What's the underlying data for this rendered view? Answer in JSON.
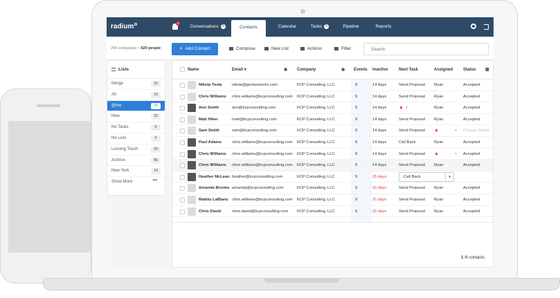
{
  "app": {
    "logo": "radium",
    "bell_count": "3"
  },
  "nav": {
    "tabs": [
      {
        "label": "Conversations",
        "count": "5"
      },
      {
        "label": "Contacts",
        "active": true
      },
      {
        "label": "Calendar"
      },
      {
        "label": "Tasks",
        "count": "5"
      },
      {
        "label": "Pipeline"
      },
      {
        "label": "Reports"
      }
    ]
  },
  "toolbar": {
    "companies": "265 companies",
    "sep": ">",
    "people": "620 people",
    "add_contact": "Add Contact",
    "plus": "+",
    "compose": "Compose",
    "new_list": "New List",
    "actions": "Actions",
    "filter": "Filter",
    "search_placeholder": "Search"
  },
  "sidebar": {
    "title": "Lists",
    "items": [
      {
        "label": "Merge",
        "count": "20"
      },
      {
        "label": "All",
        "count": "19"
      },
      {
        "label": "@me",
        "count": "20",
        "active": true
      },
      {
        "label": "New",
        "count": "20"
      },
      {
        "label": "No Tasks",
        "count": "6"
      },
      {
        "label": "No Lists",
        "count": "5"
      },
      {
        "label": "Loosing Touch",
        "count": "20"
      },
      {
        "label": "Archive",
        "count": "86"
      },
      {
        "label": "New York",
        "count": "14"
      }
    ],
    "more": "Show More",
    "more_dots": "•••"
  },
  "table": {
    "headers": {
      "name": "Name",
      "email": "Email",
      "email_sort": "▾",
      "company": "Company",
      "events": "Events",
      "inactive": "Inactive",
      "next_task": "Next Task",
      "assigned": "Assigned",
      "status": "Status"
    },
    "rows": [
      {
        "name": "Nikola Tesla",
        "email": "nikola@geniusworks.com",
        "company": "KCP Consulting, LLC",
        "events": "9",
        "inactive": "14 days",
        "next_task": "Send Proposal",
        "assigned": "Ryan",
        "status": "Accepted"
      },
      {
        "name": "Chris Williams",
        "email": "chris.williams@kcpconsulting.com",
        "company": "KCP Consulting, LLC",
        "events": "9",
        "inactive": "14 days",
        "next_task": "Send Proposal",
        "assigned": "Ryan",
        "status": "Accepted"
      },
      {
        "name": "Ann Smith",
        "email": "ann@kcpconsulting.com",
        "company": "KCP Consulting, LLC",
        "events": "9",
        "inactive": "14 days",
        "next_task": "",
        "assigned": "Ryan",
        "status": "Accepted"
      },
      {
        "name": "Matt Hiker",
        "email": "matt@kcpconsulting.com",
        "company": "KCP Consulting, LLC",
        "events": "9",
        "inactive": "14 days",
        "next_task": "Send Proposal",
        "assigned": "Ryan",
        "status": "Accepted"
      },
      {
        "name": "Sam Smith",
        "email": "sam@kcpconsulting.com",
        "company": "KCP Consulting, LLC",
        "events": "9",
        "inactive": "14 days",
        "next_task": "Send Proposal",
        "assigned": "",
        "status": "Choose Status"
      },
      {
        "name": "Paul Adams",
        "email": "chris.williams@kcpconsulting.com",
        "company": "KCP Consulting, LLC",
        "events": "9",
        "inactive": "14 days",
        "next_task": "Call Back",
        "assigned": "Ryan",
        "status": "Accepted"
      },
      {
        "name": "Chris Williams",
        "email": "chris.williams@kcpconsulting.com",
        "company": "KCP Consulting, LLC",
        "events": "9",
        "inactive": "14 days",
        "next_task": "Send Proposal",
        "assigned": "",
        "status": "Accepted"
      },
      {
        "name": "Chris Williams",
        "email": "chris.williams@kcpconsulting.com",
        "company": "KCP Consulting, LLC",
        "events": "9",
        "inactive": "14 days",
        "next_task": "Send Proposal",
        "assigned": "Ryan",
        "status": "Accepted"
      },
      {
        "name": "Heather McLean",
        "email": "heather@kcpconsulting.com",
        "company": "KCP Consulting, LLC",
        "events": "9",
        "inactive": "25 days",
        "next_task": "Call Back",
        "assigned": "",
        "status": ""
      },
      {
        "name": "Amanda Brooke",
        "email": "amanda@kcpconsulting.com",
        "company": "KCP Consulting, LLC",
        "events": "9",
        "inactive": "31 days",
        "next_task": "Send Proposal",
        "assigned": "Ryan",
        "status": "Accepted"
      },
      {
        "name": "Mathiu LaBlanc",
        "email": "chris.williams@kcpconsulting.com",
        "company": "KCP Consulting, LLC",
        "events": "9",
        "inactive": "31 days",
        "next_task": "Send Proposal",
        "assigned": "Ryan",
        "status": "Accepted"
      },
      {
        "name": "Chris David",
        "email": "chris.david@kcpconsulting.com",
        "company": "KCP Consulting, LLC",
        "events": "9",
        "inactive": "31 days",
        "next_task": "Send Proposal",
        "assigned": "Ryan",
        "status": "Accepted"
      }
    ],
    "warn_glyph": "▲",
    "dropdown_glyph": "▾"
  },
  "pager": {
    "current": "1",
    "text": "/6    contacts"
  }
}
